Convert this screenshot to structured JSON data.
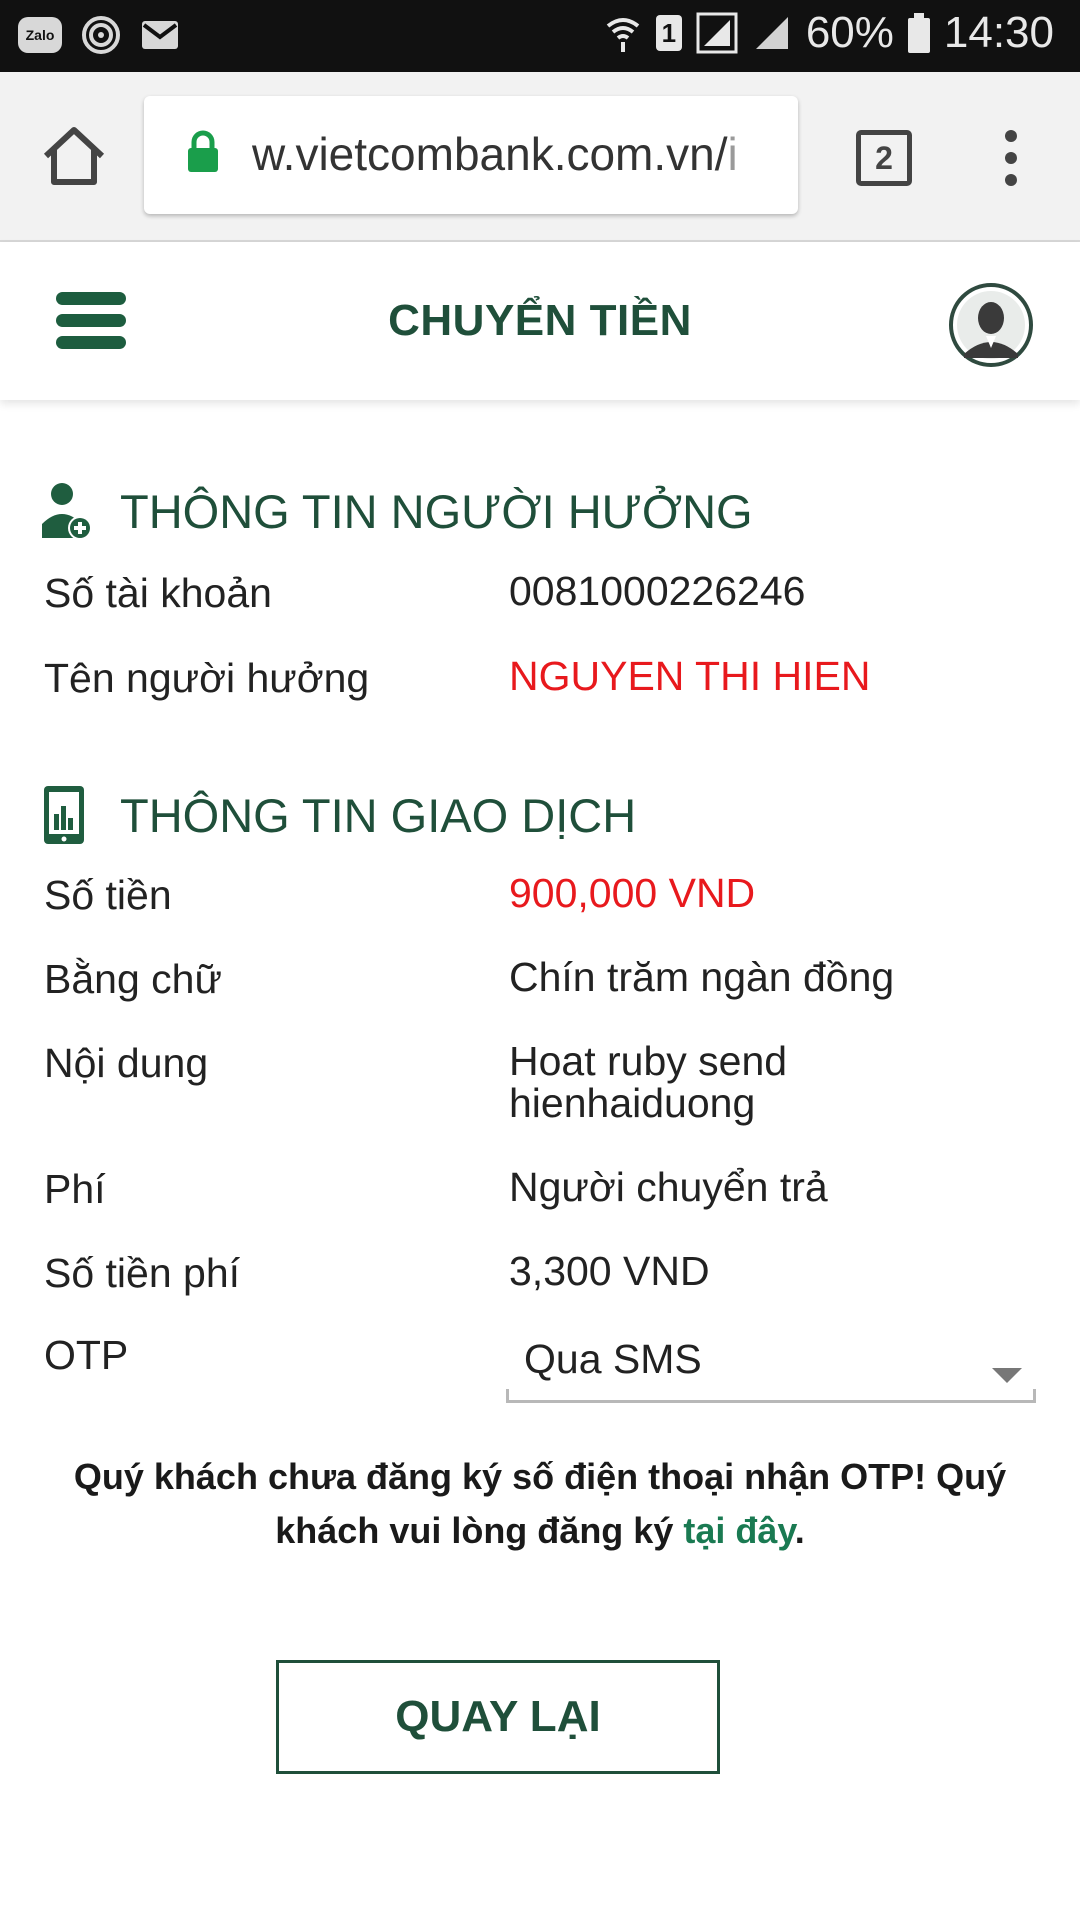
{
  "status_bar": {
    "left_icons": [
      "zalo-icon",
      "spiral-notification-icon",
      "mail-icon"
    ],
    "zalo_text": "Zalo",
    "sim_slot": "1",
    "battery_percent": "60%",
    "time": "14:30"
  },
  "browser": {
    "url_main": "w.vietcombank.com.vn/",
    "url_fade": "i",
    "tab_count": "2"
  },
  "header": {
    "title": "CHUYỂN TIỀN"
  },
  "beneficiary": {
    "section_title": "THÔNG TIN NGƯỜI HƯỞNG",
    "account_label": "Số tài khoản",
    "account_value": "0081000226246",
    "name_label": "Tên người hưởng",
    "name_value": "NGUYEN THI HIEN"
  },
  "transaction": {
    "section_title": "THÔNG TIN GIAO DỊCH",
    "amount_label": "Số tiền",
    "amount_value": "900,000 VND",
    "words_label": "Bằng chữ",
    "words_value": "Chín trăm ngàn đồng",
    "content_label": "Nội dung",
    "content_value_line1": "Hoat ruby send",
    "content_value_line2": "hienhaiduong",
    "fee_label": "Phí",
    "fee_value": "Người chuyển trả",
    "fee_amount_label": "Số tiền phí",
    "fee_amount_value": "3,300 VND",
    "otp_label": "OTP",
    "otp_selected": "Qua SMS"
  },
  "notice": {
    "text_before": "Quý khách chưa đăng ký số điện thoại nhận OTP! Quý khách vui lòng đăng ký ",
    "link_text": "tại đây",
    "text_after": "."
  },
  "actions": {
    "back_label": "QUAY LẠI"
  },
  "colors": {
    "brand_green": "#1f4f3a",
    "highlight_red": "#e8191d",
    "link_green": "#1a7a52"
  }
}
